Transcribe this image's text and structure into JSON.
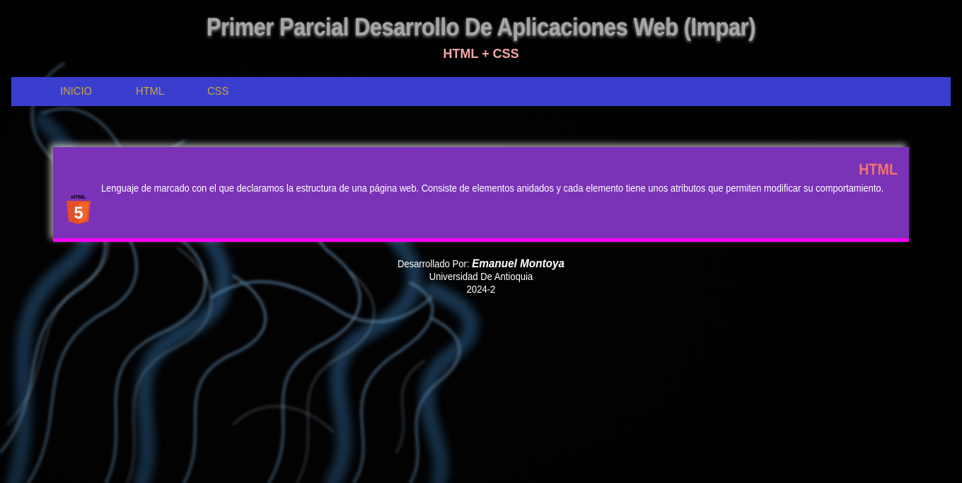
{
  "header": {
    "title": "Primer Parcial Desarrollo De Aplicaciones Web (Impar)",
    "subtitle": "HTML + CSS"
  },
  "nav": {
    "items": [
      {
        "label": "INICIO"
      },
      {
        "label": "HTML"
      },
      {
        "label": "CSS"
      }
    ]
  },
  "card": {
    "title": "HTML",
    "icon": "html5-logo-icon",
    "icon_text": "HTML",
    "icon_number": "5",
    "description": "Lenguaje de marcado con el que declaramos la estructura de una página web. Consiste de elementos anidados y cada elemento tiene unos atributos que permiten modificar su comportamiento."
  },
  "footer": {
    "developed_by_label": "Desarrollado Por:",
    "author": "Emanuel Montoya",
    "university": "Universidad De Antioquia",
    "period": "2024-2"
  },
  "colors": {
    "nav_background": "#3c40d6",
    "nav_link": "#c9a738",
    "card_background": "#7a32b7",
    "card_border": "#ff00ff",
    "card_title": "#f2746a",
    "subtitle": "#f4a6a6"
  }
}
